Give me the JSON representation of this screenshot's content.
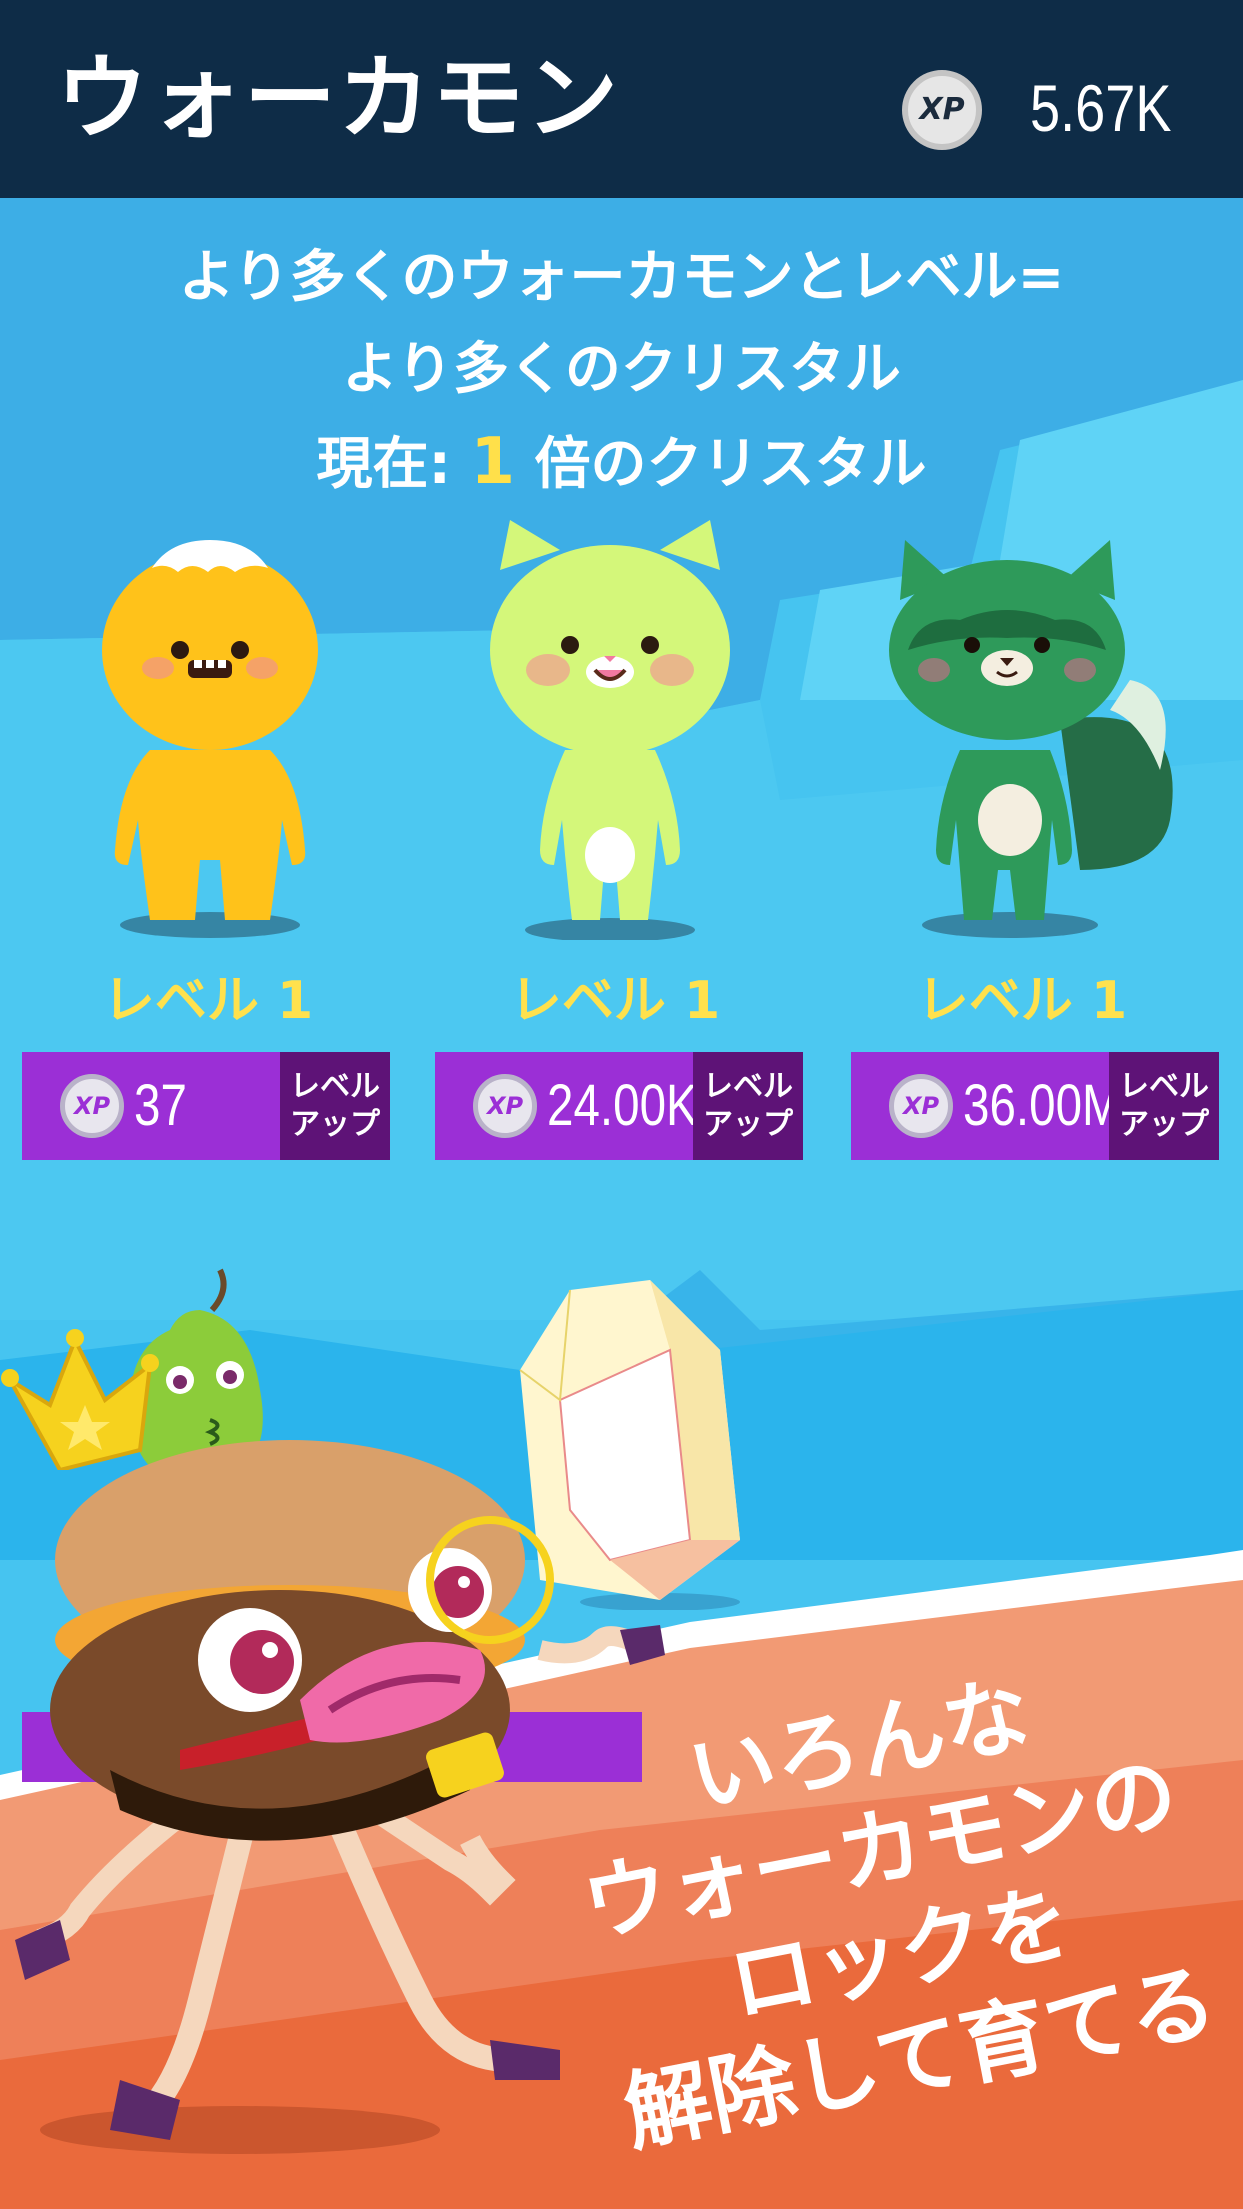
{
  "header": {
    "title": "ウォーカモン",
    "xp_icon": "XP",
    "xp_total": "5.67K"
  },
  "intro": {
    "line1": "より多くのウォーカモンとレベル=",
    "line2": "より多くのクリスタル",
    "current_prefix": "現在:",
    "multiplier": "1",
    "current_suffix": "倍のクリスタル"
  },
  "walkamons": [
    {
      "name": "yellow-monster",
      "level_label": "レベル 1",
      "cost": "37",
      "button_label_line1": "レベル",
      "button_label_line2": "アップ",
      "color": "#ffc21a"
    },
    {
      "name": "lime-cat",
      "level_label": "レベル 1",
      "cost": "24.00K",
      "button_label_line1": "レベル",
      "button_label_line2": "アップ",
      "color": "#d4f77a"
    },
    {
      "name": "green-raccoon",
      "level_label": "レベル 1",
      "cost": "36.00M",
      "button_label_line1": "レベル",
      "button_label_line2": "アップ",
      "color": "#2e9a5a"
    }
  ],
  "promo": {
    "line1": "いろんな",
    "line2": "ウォーカモンの",
    "line3": "ロックを",
    "line4": "解除して育てる"
  },
  "colors": {
    "header_bg": "#0e2c47",
    "sky": "#3fc0ee",
    "button_purple": "#9b2fd6",
    "button_dark": "#5e1377",
    "level_yellow": "#ffe14d",
    "promo_orange": "#ea6a3c"
  }
}
